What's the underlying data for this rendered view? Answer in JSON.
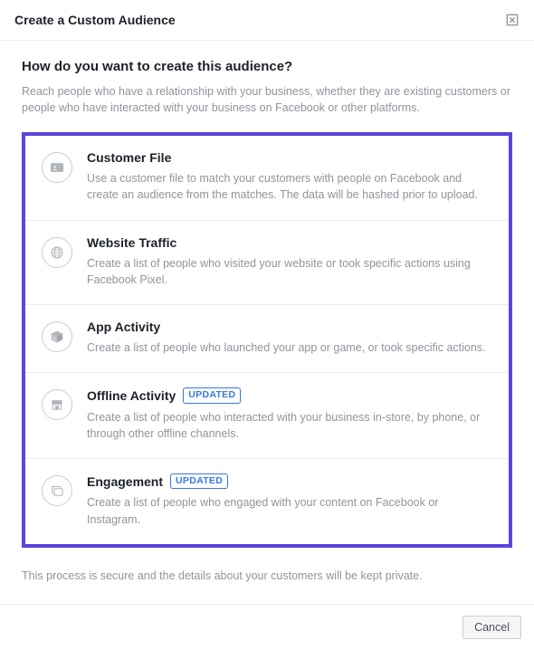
{
  "header": {
    "title": "Create a Custom Audience"
  },
  "body": {
    "question": "How do you want to create this audience?",
    "subtext": "Reach people who have a relationship with your business, whether they are existing customers or people who have interacted with your business on Facebook or other platforms.",
    "footnote": "This process is secure and the details about your customers will be kept private."
  },
  "options": [
    {
      "title": "Customer File",
      "desc": "Use a customer file to match your customers with people on Facebook and create an audience from the matches. The data will be hashed prior to upload."
    },
    {
      "title": "Website Traffic",
      "desc": "Create a list of people who visited your website or took specific actions using Facebook Pixel."
    },
    {
      "title": "App Activity",
      "desc": "Create a list of people who launched your app or game, or took specific actions."
    },
    {
      "title": "Offline Activity",
      "badge": "UPDATED",
      "desc": "Create a list of people who interacted with your business in-store, by phone, or through other offline channels."
    },
    {
      "title": "Engagement",
      "badge": "UPDATED",
      "desc": "Create a list of people who engaged with your content on Facebook or Instagram."
    }
  ],
  "footer": {
    "cancel": "Cancel"
  }
}
